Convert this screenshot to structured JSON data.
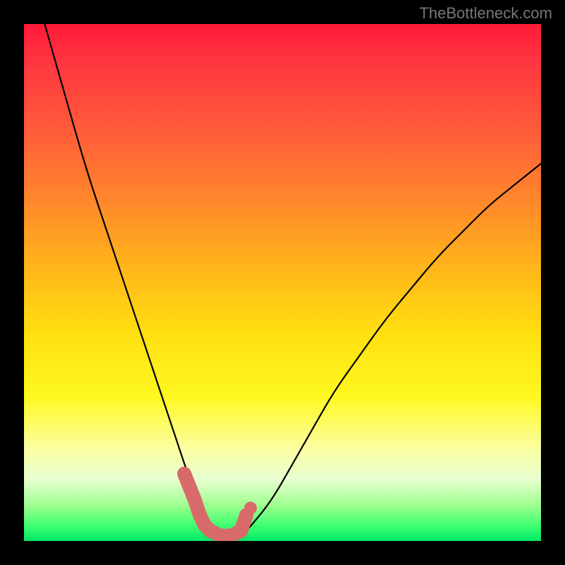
{
  "watermark": "TheBottleneck.com",
  "chart_data": {
    "type": "line",
    "title": "",
    "xlabel": "",
    "ylabel": "",
    "xlim": [
      0,
      100
    ],
    "ylim": [
      0,
      100
    ],
    "series": [
      {
        "name": "bottleneck-curve",
        "x": [
          4,
          8,
          12,
          16,
          20,
          24,
          28,
          30,
          32,
          34,
          36,
          38,
          40,
          42,
          44,
          48,
          52,
          56,
          60,
          65,
          70,
          75,
          80,
          85,
          90,
          95,
          100
        ],
        "values": [
          100,
          86,
          72,
          60,
          48,
          36,
          24,
          18,
          12,
          7,
          3,
          1,
          0,
          1,
          3,
          8,
          15,
          22,
          29,
          36,
          43,
          49,
          55,
          60,
          65,
          69,
          73
        ]
      }
    ],
    "marker_segment": {
      "name": "valley-marker",
      "x": [
        31,
        33,
        34,
        35,
        36,
        38,
        40,
        42,
        43
      ],
      "values": [
        13,
        8,
        5,
        3,
        2,
        1,
        1,
        2,
        5
      ],
      "color": "#d96a6a"
    },
    "colors": {
      "curve": "#000000",
      "marker": "#d96a6a",
      "gradient_top": "#ff1a3a",
      "gradient_bottom": "#00e865"
    }
  }
}
